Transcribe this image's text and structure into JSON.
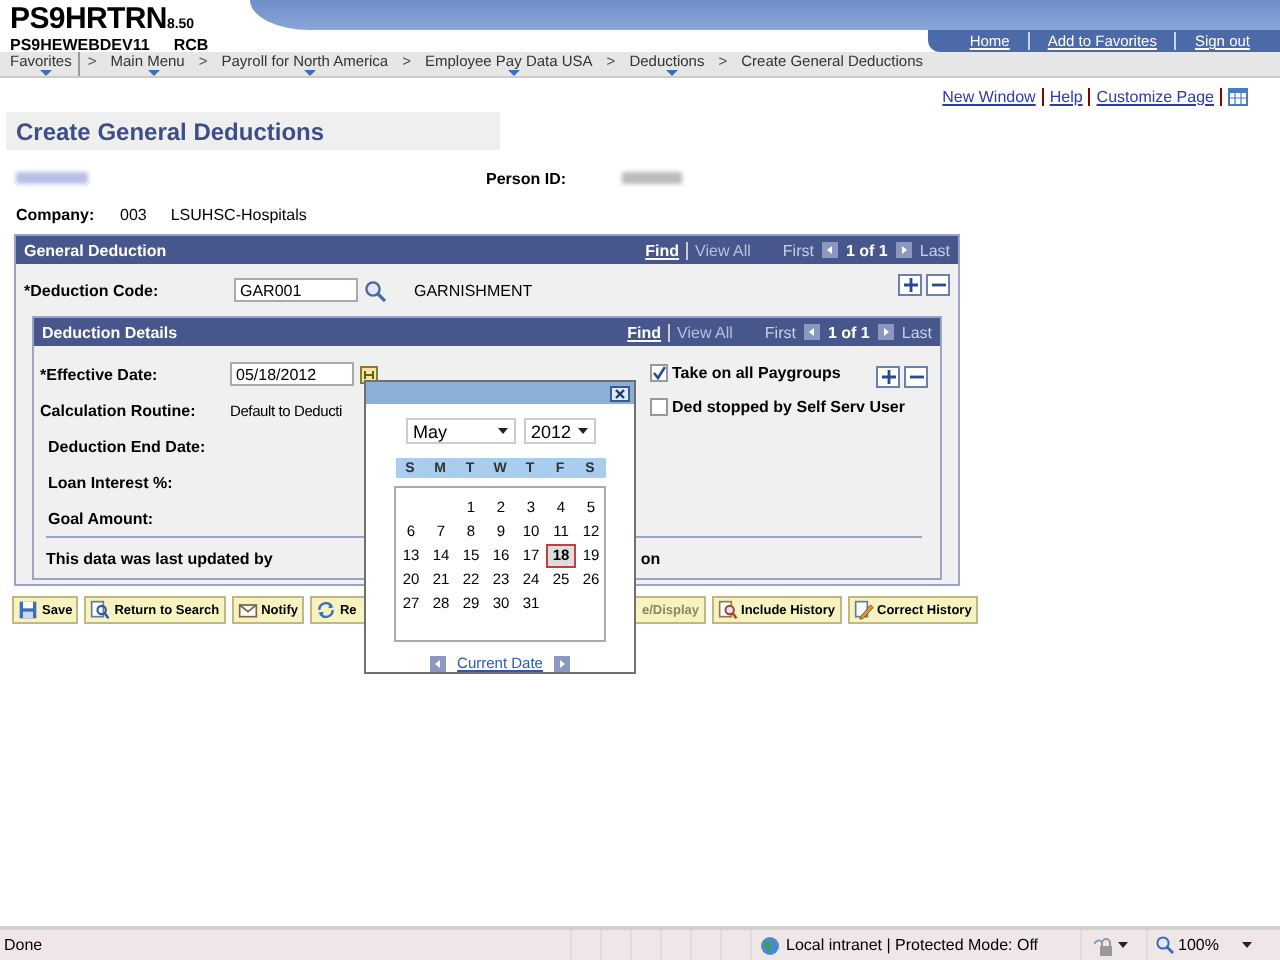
{
  "header": {
    "app_name": "PS9HRTRN",
    "version": "8.50",
    "server": "PS9HEWEBDEV11",
    "user": "RCB",
    "links": [
      "Home",
      "Add to Favorites",
      "Sign out"
    ]
  },
  "breadcrumbs": [
    {
      "label": "Favorites",
      "menu": true
    },
    {
      "label": "Main Menu",
      "menu": true,
      "separator": ">"
    },
    {
      "label": "Payroll for North America",
      "menu": true,
      "separator": ">"
    },
    {
      "label": "Employee Pay Data USA",
      "menu": true,
      "separator": ">"
    },
    {
      "label": "Deductions",
      "menu": true,
      "separator": ">"
    },
    {
      "label": "Create General Deductions",
      "menu": false,
      "separator": ">"
    }
  ],
  "page_links": [
    "New Window",
    "Help",
    "Customize Page"
  ],
  "page_title": "Create General Deductions",
  "person_id_label": "Person ID:",
  "company": {
    "label": "Company:",
    "code": "003",
    "name": "LSUHSC-Hospitals"
  },
  "general_deduction": {
    "title": "General Deduction",
    "find": "Find",
    "view_all": "View All",
    "first": "First",
    "count": "1 of 1",
    "last": "Last",
    "code_label": "*Deduction Code:",
    "code_value": "GAR001",
    "code_description": "GARNISHMENT"
  },
  "deduction_details": {
    "title": "Deduction Details",
    "find": "Find",
    "view_all": "View All",
    "first": "First",
    "count": "1 of 1",
    "last": "Last",
    "fields": [
      {
        "label": "*Effective Date:",
        "kind": "date",
        "value": "05/18/2012"
      },
      {
        "label": "Calculation Routine:",
        "kind": "text",
        "value": "Default to Deducti"
      },
      {
        "label": "Deduction End Date:",
        "kind": "empty"
      },
      {
        "label": "Loan Interest %:",
        "kind": "empty"
      },
      {
        "label": "Goal Amount:",
        "kind": "empty"
      }
    ],
    "checkboxes": [
      {
        "label": "Take on all Paygroups",
        "checked": true
      },
      {
        "label": "Ded stopped by Self Serv User",
        "checked": false
      }
    ],
    "last_updated": "This data was last updated by",
    "last_updated_tail": "on"
  },
  "buttons": [
    {
      "label": "Save",
      "kind": "save",
      "disabled": false
    },
    {
      "label": "Return to Search",
      "kind": "search",
      "disabled": false
    },
    {
      "label": "Notify",
      "kind": "notify",
      "disabled": false
    },
    {
      "label": "Re",
      "kind": "refresh",
      "disabled": false
    },
    {
      "label": "e/Display",
      "kind": "plain",
      "disabled": true
    },
    {
      "label": "Include History",
      "kind": "history",
      "disabled": false
    },
    {
      "label": "Correct History",
      "kind": "correct",
      "disabled": false
    }
  ],
  "calendar": {
    "month": "May",
    "year": "2012",
    "weekdays": [
      "S",
      "M",
      "T",
      "W",
      "T",
      "F",
      "S"
    ],
    "weeks": [
      {
        "days": [
          {
            "day": "1",
            "selected": false
          },
          {
            "day": "2",
            "selected": false
          },
          {
            "day": "3",
            "selected": false
          },
          {
            "day": "4",
            "selected": false
          },
          {
            "day": "5",
            "selected": false
          }
        ]
      },
      {
        "days": [
          {
            "day": "6",
            "selected": false
          },
          {
            "day": "7",
            "selected": false
          },
          {
            "day": "8",
            "selected": false
          },
          {
            "day": "9",
            "selected": false
          },
          {
            "day": "10",
            "selected": false
          },
          {
            "day": "11",
            "selected": false
          },
          {
            "day": "12",
            "selected": false
          }
        ]
      },
      {
        "days": [
          {
            "day": "13",
            "selected": false
          },
          {
            "day": "14",
            "selected": false
          },
          {
            "day": "15",
            "selected": false
          },
          {
            "day": "16",
            "selected": false
          },
          {
            "day": "17",
            "selected": false
          },
          {
            "day": "18",
            "selected": true
          },
          {
            "day": "19",
            "selected": false
          }
        ]
      },
      {
        "days": [
          {
            "day": "20",
            "selected": false
          },
          {
            "day": "21",
            "selected": false
          },
          {
            "day": "22",
            "selected": false
          },
          {
            "day": "23",
            "selected": false
          },
          {
            "day": "24",
            "selected": false
          },
          {
            "day": "25",
            "selected": false
          },
          {
            "day": "26",
            "selected": false
          }
        ]
      },
      {
        "days": [
          {
            "day": "27",
            "selected": false
          },
          {
            "day": "28",
            "selected": false
          },
          {
            "day": "29",
            "selected": false
          },
          {
            "day": "30",
            "selected": false
          },
          {
            "day": "31",
            "selected": false
          }
        ]
      }
    ],
    "current_date": "Current Date"
  },
  "status_bar": {
    "text": "Done",
    "zone": "Local intranet | Protected Mode: Off",
    "zoom": "100%"
  }
}
